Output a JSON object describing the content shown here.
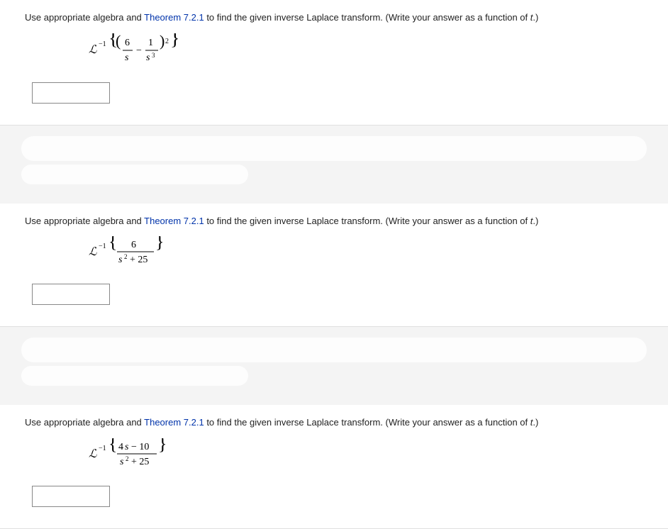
{
  "questions": [
    {
      "prompt_prefix": "Use appropriate algebra and ",
      "theorem": "Theorem 7.2.1",
      "prompt_middle": " to find the given inverse Laplace transform. (Write your answer as a function of ",
      "var": "t",
      "prompt_suffix": ".)",
      "formula_tex": "\\mathscr{L}^{-1}\\left\\{ \\left( \\frac{6}{s} - \\frac{1}{s^{3}} \\right)^{2} \\right\\}",
      "answer": ""
    },
    {
      "prompt_prefix": "Use appropriate algebra and ",
      "theorem": "Theorem 7.2.1",
      "prompt_middle": " to find the given inverse Laplace transform. (Write your answer as a function of ",
      "var": "t",
      "prompt_suffix": ".)",
      "formula_tex": "\\mathscr{L}^{-1}\\left\\{ \\frac{6}{s^{2}+25} \\right\\}",
      "answer": ""
    },
    {
      "prompt_prefix": "Use appropriate algebra and ",
      "theorem": "Theorem 7.2.1",
      "prompt_middle": " to find the given inverse Laplace transform. (Write your answer as a function of ",
      "var": "t",
      "prompt_suffix": ".)",
      "formula_tex": "\\mathscr{L}^{-1}\\left\\{ \\frac{4s - 10}{s^{2}+25} \\right\\}",
      "answer": ""
    }
  ]
}
